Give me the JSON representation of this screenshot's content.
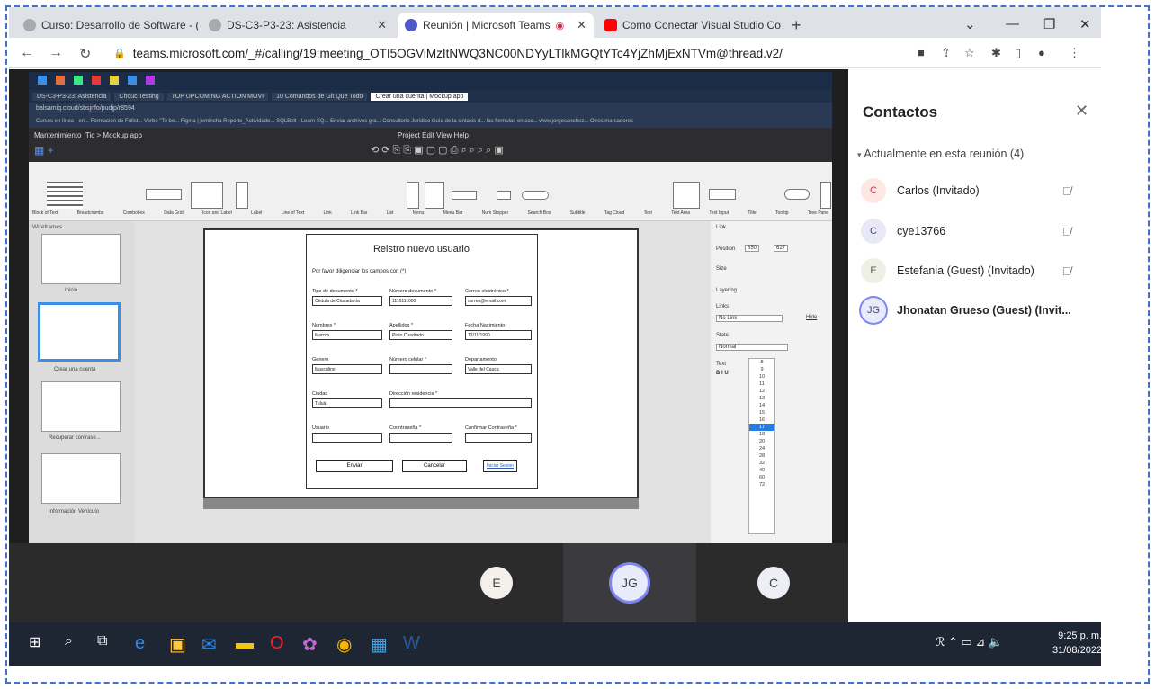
{
  "browser": {
    "tabs": [
      {
        "title": "Curso: Desarrollo de Software - (",
        "color": "#7a7a7a"
      },
      {
        "title": "DS-C3-P3-23: Asistencia",
        "color": "#7a7a7a"
      },
      {
        "title": "Reunión | Microsoft Teams",
        "color": "#5059c9"
      },
      {
        "title": "Como Conectar Visual Studio Co",
        "color": "#ff0000"
      }
    ],
    "url": "teams.microsoft.com/_#/calling/19:meeting_OTI5OGViMzItNWQ3NC00NDYyLTlkMGQtYTc4YjZhMjExNTVm@thread.v2/"
  },
  "shared_screen": {
    "inner_tabs": [
      "DS-C3-P3-23: Asistencia",
      "Chouc Testing",
      "TOP UPCOMING ACTION MOVI",
      "10 Comandos de Git Que Todo",
      "Crear una cuenta | Mockup app"
    ],
    "inner_url": "balsamiq.cloud/sbsjnfo/pudjp/r8594",
    "inner_bookmarks": "Cursos en línea - en...  Formación de Fullst...  Verbo \"To be...  Figma | jemincha  Reporte_Actividade...  SQLBolt - Learn SQ...  Enviar archivos gra...  Consultorio Jurídico  Guía de la sintaxis d...  las formulas en acc...  www.jorgesanchez...  Otros marcadores",
    "project_title": "Mantenimiento_Tic > Mockup app",
    "menu": "Project  Edit  View  Help",
    "library": [
      "Block of Text",
      "Breadcrumbs",
      "Combobox",
      "Data Grid",
      "Icon and Label",
      "Label",
      "Line of Text",
      "Link",
      "Link Bar",
      "List",
      "Menu",
      "Menu Bar",
      "Num Stepper",
      "Search Box",
      "Subtitle",
      "Tag Cloud",
      "Text",
      "Text Area",
      "Text Input",
      "Title",
      "Tooltip",
      "Tree Pane"
    ],
    "wireframes_label": "Wireframes",
    "thumbs": [
      "Inicio",
      "Crear una cuenta",
      "Recuperar contrase...",
      "Información Vehículo"
    ],
    "form": {
      "title": "Reistro nuevo usuario",
      "subtitle": "Por favor diligenciar los campos con (*)",
      "tipo_label": "Tipo de documento *",
      "tipo_value": "Cédula de Ciudadanía",
      "numdoc_label": "Número documento *",
      "numdoc_value": "1116111000",
      "correo_label": "Correo electrónico *",
      "correo_value": "correo@email.com",
      "nombres_label": "Nombres *",
      "nombres_value": "Marcos",
      "apellidos_label": "Apellidos *",
      "apellidos_value": "Pinto Cuadrado",
      "fecha_label": "Fecha Nacimiento",
      "fecha_value": "12/11/1990",
      "genero_label": "Genero",
      "genero_value": "Masculino",
      "celular_label": "Número celular *",
      "depto_label": "Departamento",
      "depto_value": "Valle del Cauca",
      "ciudad_label": "Ciudad",
      "ciudad_value": "Tuluá",
      "direccion_label": "Dirección residencia *",
      "usuario_label": "Usuario",
      "contrasena_label": "Coontraseña *",
      "confirmar_label": "Confirmar Contraseña *",
      "enviar": "Enviar",
      "cancelar": "Cancelar",
      "iniciar": "Iniciar Sesion"
    },
    "props": {
      "link": "Link",
      "position": "Position",
      "pos_x": "850",
      "pos_y": "627",
      "size": "Size",
      "layering": "Layering",
      "links": "Links",
      "no_link": "No Link",
      "hide": "Hide",
      "state": "State",
      "state_value": "Normal",
      "text": "Text"
    },
    "font_sizes": [
      "8",
      "9",
      "10",
      "11",
      "12",
      "13",
      "14",
      "15",
      "16",
      "17",
      "18",
      "20",
      "24",
      "28",
      "32",
      "40",
      "60",
      "72"
    ]
  },
  "participants": [
    {
      "initials": "E",
      "bg": "#f3efea",
      "fg": "#444"
    },
    {
      "initials": "JG",
      "bg": "#e8ebfa",
      "fg": "#444"
    },
    {
      "initials": "C",
      "bg": "#eeeef7",
      "fg": "#444"
    }
  ],
  "contacts": {
    "title": "Contactos",
    "group_label": "Actualmente en esta reunión (4)",
    "people": [
      {
        "initials": "C",
        "name": "Carlos (Invitado)",
        "bg": "#fde7e2",
        "fg": "#c4314b",
        "muted": true
      },
      {
        "initials": "C",
        "name": "cye13766",
        "bg": "#e8e8f6",
        "fg": "#464775",
        "muted": true
      },
      {
        "initials": "E",
        "name": "Estefania (Guest) (Invitado)",
        "bg": "#eef0e8",
        "fg": "#5a5a44",
        "muted": true
      },
      {
        "initials": "JG",
        "name": "Jhonatan Grueso (Guest) (Invit...",
        "bg": "#e8ebfa",
        "fg": "#464775",
        "muted": false
      }
    ]
  },
  "taskbar": {
    "time": "9:25 p. m.",
    "date": "31/08/2022"
  }
}
